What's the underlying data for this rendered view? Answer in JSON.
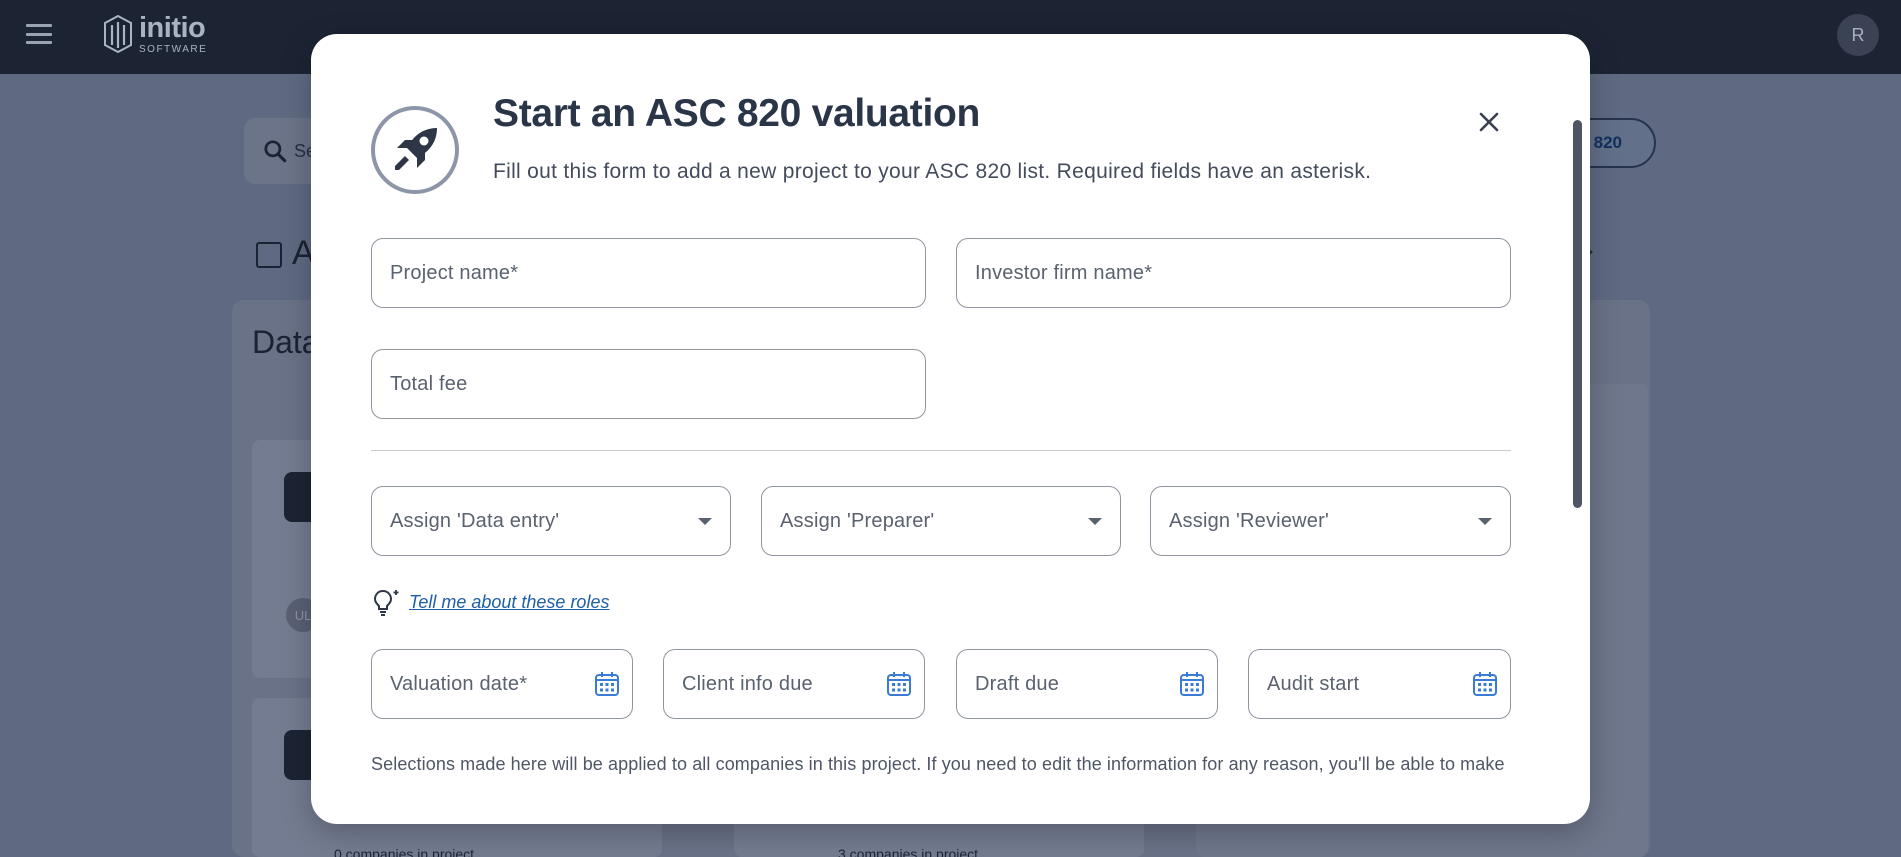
{
  "app": {
    "logo_word": "initio",
    "logo_sub": "SOFTWARE",
    "avatar_initial": "R"
  },
  "background": {
    "search_text": "Se",
    "header_pill_text": "820",
    "heading": "A",
    "sort_label": "t",
    "panel_title": "Data",
    "card1_avatar": "UL",
    "card1_companies": "0 companies in project",
    "card2_companies": "3 companies in project"
  },
  "modal": {
    "title": "Start an ASC 820 valuation",
    "subtitle": "Fill out this form to add a new project to your ASC 820 list. Required fields have an asterisk.",
    "fields": {
      "project_name": "Project name*",
      "investor_firm": "Investor firm name*",
      "total_fee": "Total fee"
    },
    "assign": {
      "data_entry": "Assign 'Data entry'",
      "preparer": "Assign 'Preparer'",
      "reviewer": "Assign 'Reviewer'"
    },
    "roles_link": "Tell me about these roles",
    "dates": {
      "valuation_date": "Valuation date*",
      "client_info_due": "Client info due",
      "draft_due": "Draft due",
      "audit_start": "Audit start"
    },
    "note": "Selections made here will be applied to all companies in this project. If you need to edit the information for any reason, you'll be able to make"
  },
  "colors": {
    "topbar": "#1c2434",
    "overlay": "#5f6a82",
    "title": "#2b3548",
    "link": "#1f5fa8",
    "calendar_icon": "#3a7bd5"
  },
  "icons": [
    "menu-icon",
    "initio-logo",
    "search-icon",
    "chart-icon",
    "chevron-down-icon",
    "rocket-icon",
    "close-icon",
    "caret-down-icon",
    "lightbulb-icon",
    "calendar-icon"
  ]
}
